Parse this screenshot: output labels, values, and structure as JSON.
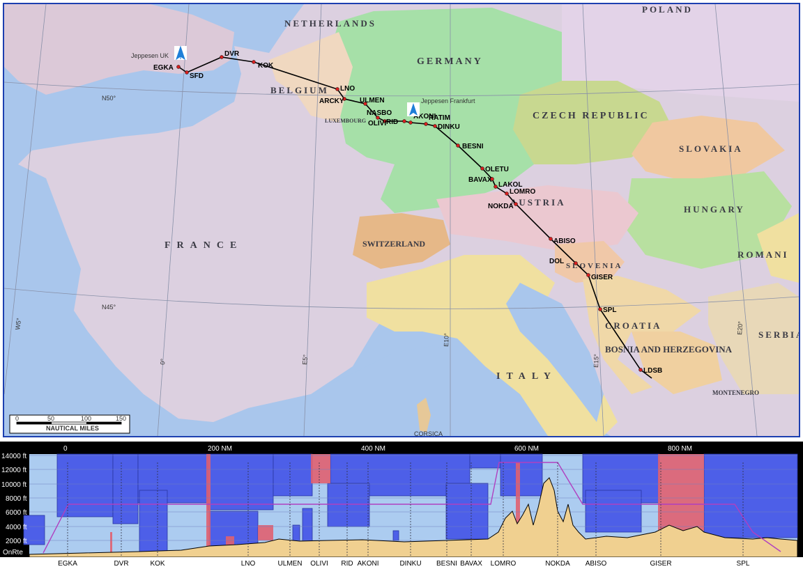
{
  "map": {
    "countries": [
      {
        "id": "poland",
        "label": "POLAND"
      },
      {
        "id": "netherlands",
        "label": "NETHERLANDS"
      },
      {
        "id": "germany",
        "label": "GERMANY"
      },
      {
        "id": "belgium",
        "label": "BELGIUM"
      },
      {
        "id": "luxembourg",
        "label": "LUXEMBOURG"
      },
      {
        "id": "czech",
        "label": "CZECH REPUBLIC"
      },
      {
        "id": "slovakia",
        "label": "SLOVAKIA"
      },
      {
        "id": "hungary",
        "label": "HUNGARY"
      },
      {
        "id": "austria",
        "label": "AUSTRIA"
      },
      {
        "id": "france",
        "label": "FRANCE"
      },
      {
        "id": "switzerland",
        "label": "SWITZERLAND"
      },
      {
        "id": "slovenia",
        "label": "SLOVENIA"
      },
      {
        "id": "romania",
        "label": "ROMANI"
      },
      {
        "id": "croatia",
        "label": "CROATIA"
      },
      {
        "id": "serbia",
        "label": "SERBIA"
      },
      {
        "id": "bosnia",
        "label": "BOSNIA AND HERZEGOVINA"
      },
      {
        "id": "italy",
        "label": "ITALY"
      },
      {
        "id": "montenegro",
        "label": "MONTENEGRO"
      },
      {
        "id": "corsica",
        "label": "CORSICA"
      }
    ],
    "waypoints": [
      "EGKA",
      "SFD",
      "DVR",
      "KOK",
      "LNO",
      "ARCKY",
      "ULMEN",
      "NASBO",
      "OLIVI",
      "RID",
      "AKONI",
      "RATIM",
      "DINKU",
      "BESNI",
      "OLETU",
      "BAVAX",
      "LAKOL",
      "LOMRO",
      "NOKDA",
      "ABISO",
      "DOL",
      "GISER",
      "SPL",
      "LDSB"
    ],
    "offices": [
      {
        "id": "uk",
        "label": "Jeppesen UK"
      },
      {
        "id": "frankfurt",
        "label": "Jeppesen Frankfurt"
      }
    ],
    "gridlabels": {
      "n50": "N50°",
      "n45": "N45°",
      "e5": "E5°",
      "e10": "E10°",
      "e15": "E15°",
      "e20": "E20°",
      "w5": "W5°",
      "zero": "0°"
    },
    "scale": {
      "ticks": [
        "0",
        "50",
        "100",
        "150"
      ],
      "label": "NAUTICAL MILES"
    },
    "colors": {
      "sea": "#a9c6ec",
      "route": "#000000",
      "waypoint": "#d62020",
      "office": "#1e7fd8"
    }
  },
  "profile": {
    "distance_labels": [
      "0",
      "200 NM",
      "400 NM",
      "600 NM",
      "800 NM"
    ],
    "altitude_labels": [
      "14000 ft",
      "12000 ft",
      "10000 ft",
      "8000 ft",
      "6000 ft",
      "4000 ft",
      "2000 ft",
      "OnRte"
    ],
    "waypoints": [
      "EGKA",
      "DVR",
      "KOK",
      "LNO",
      "ULMEN",
      "OLIVI",
      "RID",
      "AKONI",
      "DINKU",
      "BESNI",
      "BAVAX",
      "LOMRO",
      "NOKDA",
      "ABISO",
      "GISER",
      "SPL"
    ],
    "colors": {
      "airspace": "#4d5fe8",
      "sky": "#acccf0",
      "restricted": "#e06070",
      "terrain": "#f0d090",
      "route": "#b040c0"
    }
  }
}
